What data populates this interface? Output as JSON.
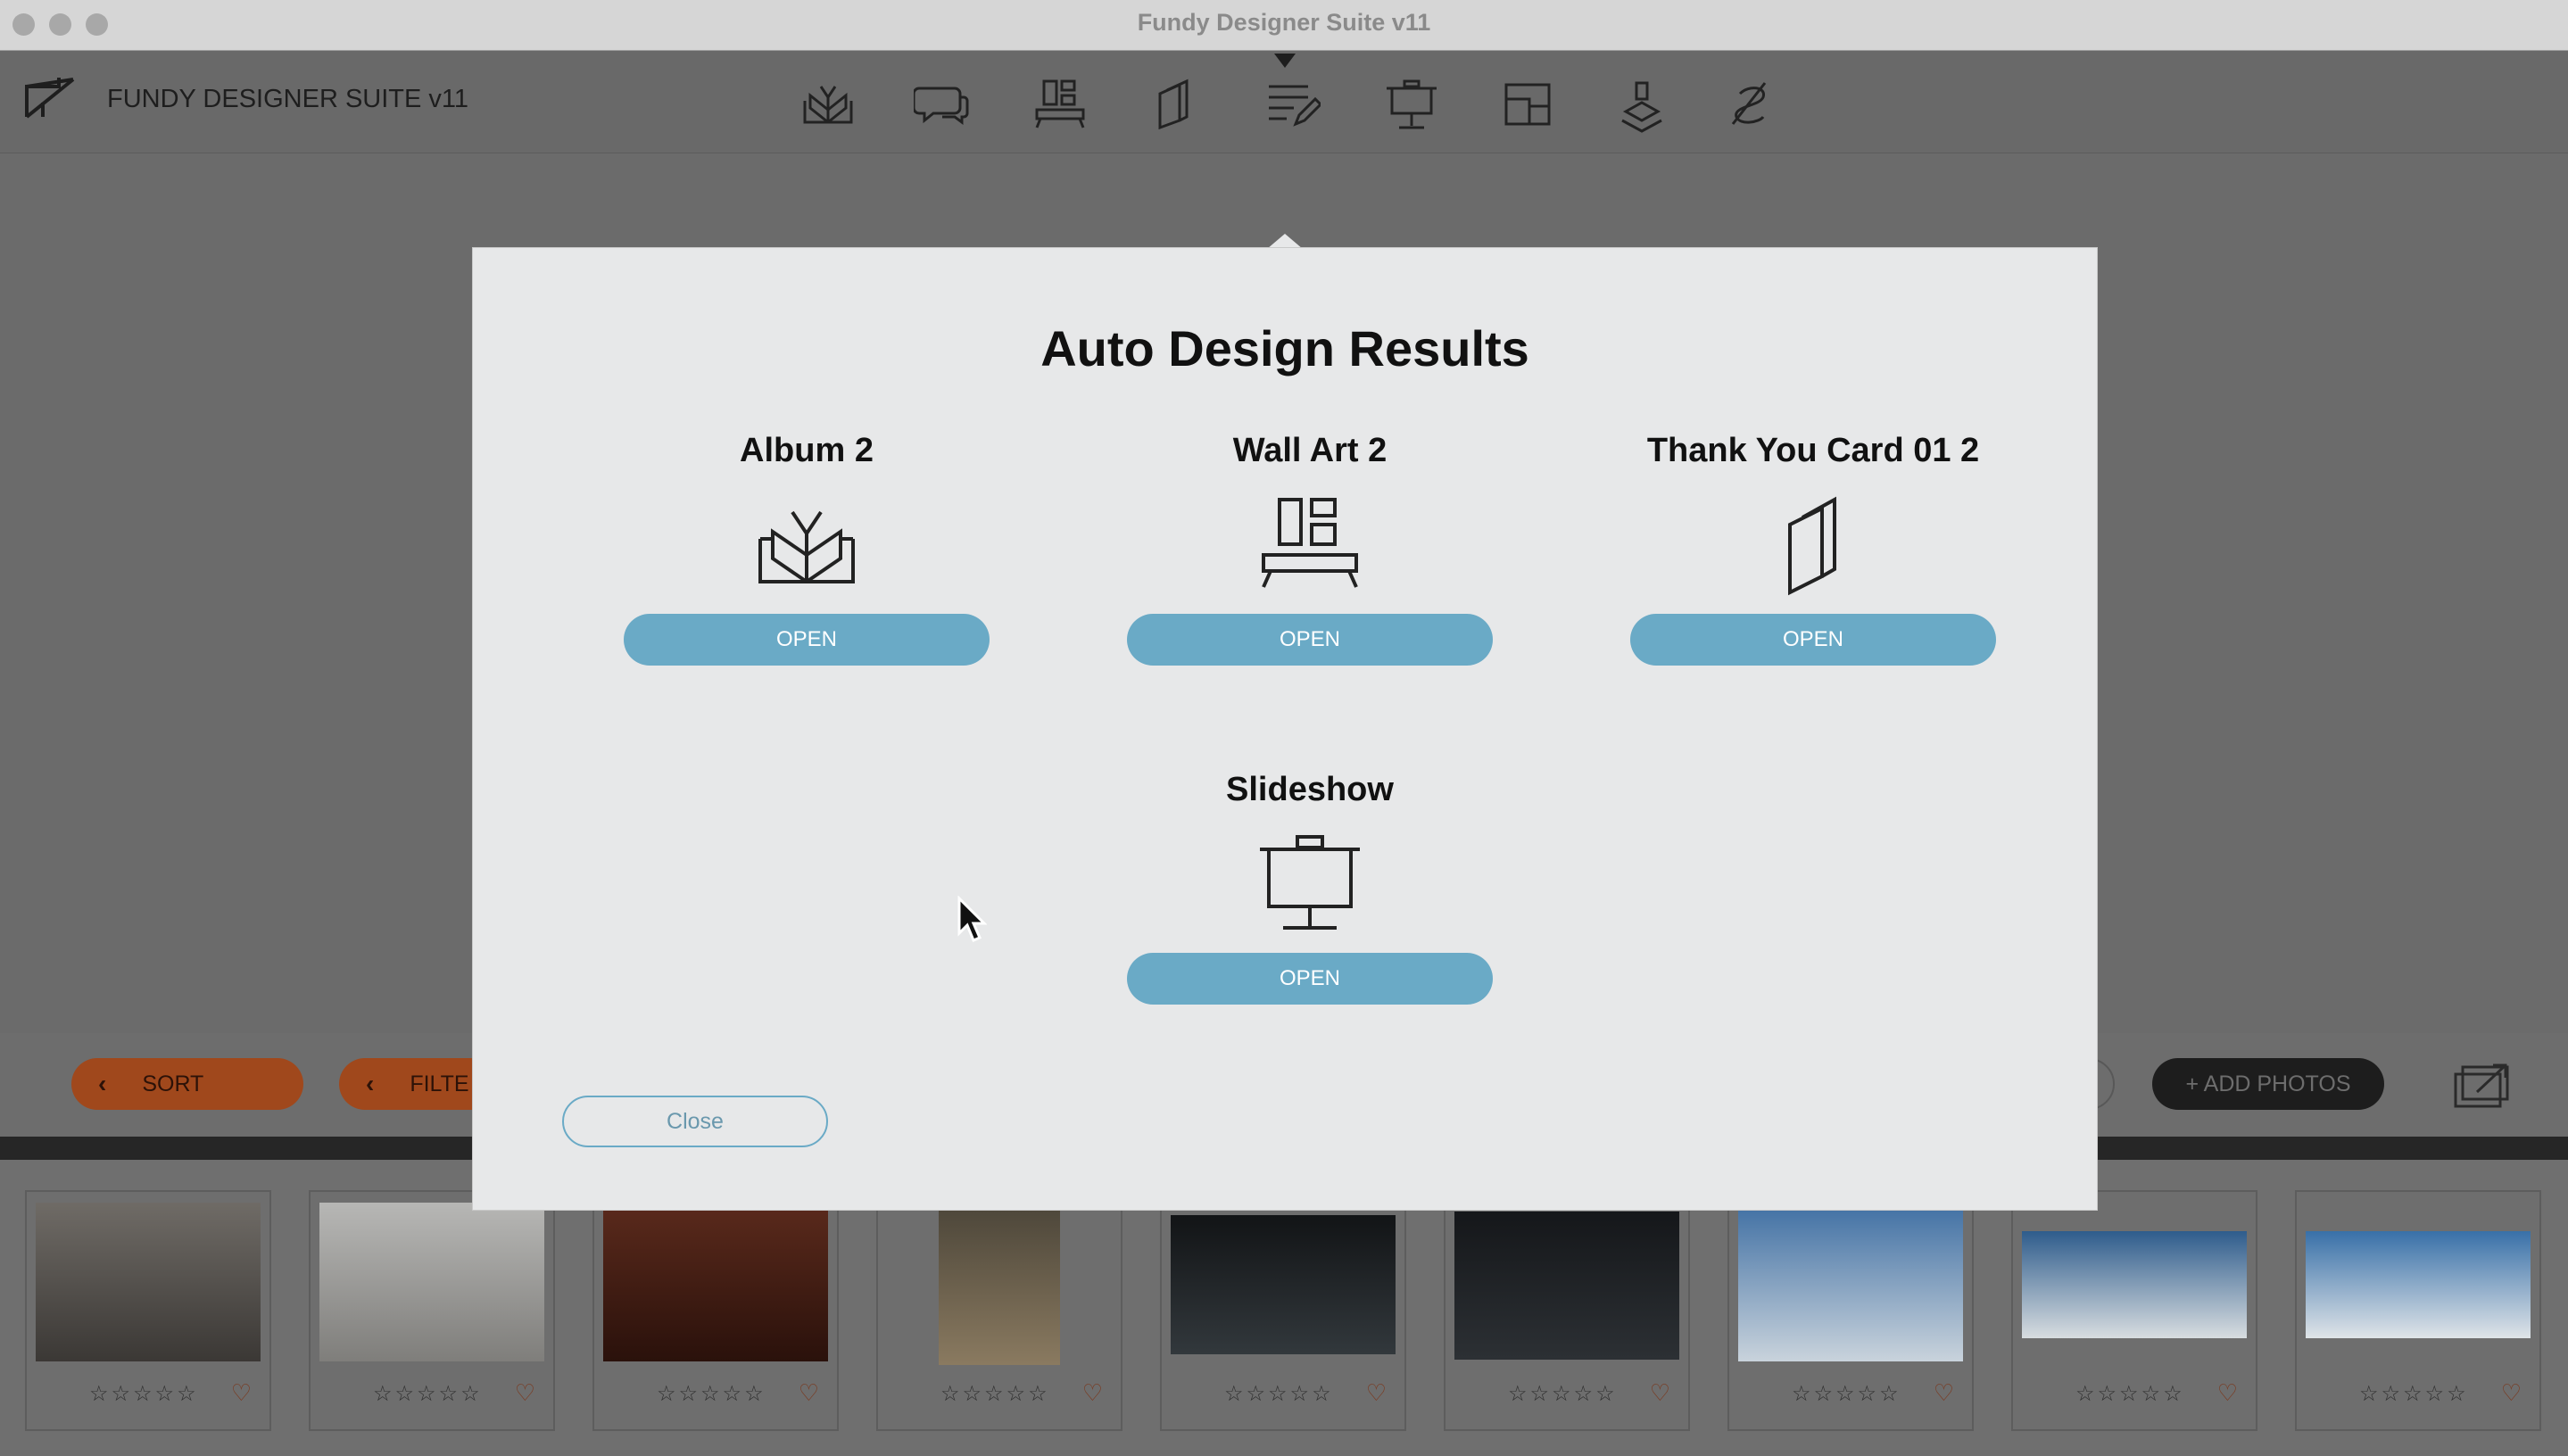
{
  "window": {
    "title": "Fundy Designer Suite v11"
  },
  "header": {
    "app_name": "FUNDY DESIGNER SUITE v11",
    "tools": [
      "album-icon",
      "chat-icon",
      "wall-art-icon",
      "card-icon",
      "proofing-icon",
      "slideshow-icon",
      "layout-icon",
      "stamp-icon",
      "signature-icon"
    ]
  },
  "bottombar": {
    "sort_label": "SORT",
    "filter_label": "FILTE",
    "add_photos_label": "+ ADD PHOTOS"
  },
  "filmstrip": {
    "stars": "☆☆☆☆☆",
    "heart": "♡",
    "photos": [
      {
        "colors": [
          "#6f6b66",
          "#3b3835"
        ]
      },
      {
        "colors": [
          "#b7b7b5",
          "#7f7e7b"
        ]
      },
      {
        "colors": [
          "#5b2a1c",
          "#2a110b"
        ]
      },
      {
        "colors": [
          "#4a4438",
          "#8a7a60"
        ]
      },
      {
        "colors": [
          "#121416",
          "#32383c"
        ]
      },
      {
        "colors": [
          "#15171a",
          "#2c3034"
        ]
      },
      {
        "colors": [
          "#3f6fa3",
          "#c9d3dc"
        ]
      },
      {
        "colors": [
          "#2e5c8c",
          "#d8dde0"
        ]
      },
      {
        "colors": [
          "#3870a8",
          "#dfe4e8"
        ]
      }
    ]
  },
  "modal": {
    "title": "Auto Design Results",
    "results": [
      {
        "name": "Album 2",
        "icon": "album-icon",
        "open_label": "OPEN"
      },
      {
        "name": "Wall Art 2",
        "icon": "wall-art-icon",
        "open_label": "OPEN"
      },
      {
        "name": "Thank You Card 01 2",
        "icon": "card-icon",
        "open_label": "OPEN"
      },
      {
        "name": "Slideshow",
        "icon": "slideshow-icon",
        "open_label": "OPEN"
      }
    ],
    "close_label": "Close"
  },
  "colors": {
    "accent": "#6aaac6",
    "sort_orange": "#a0481c",
    "modal_bg": "#e7e8e9"
  }
}
